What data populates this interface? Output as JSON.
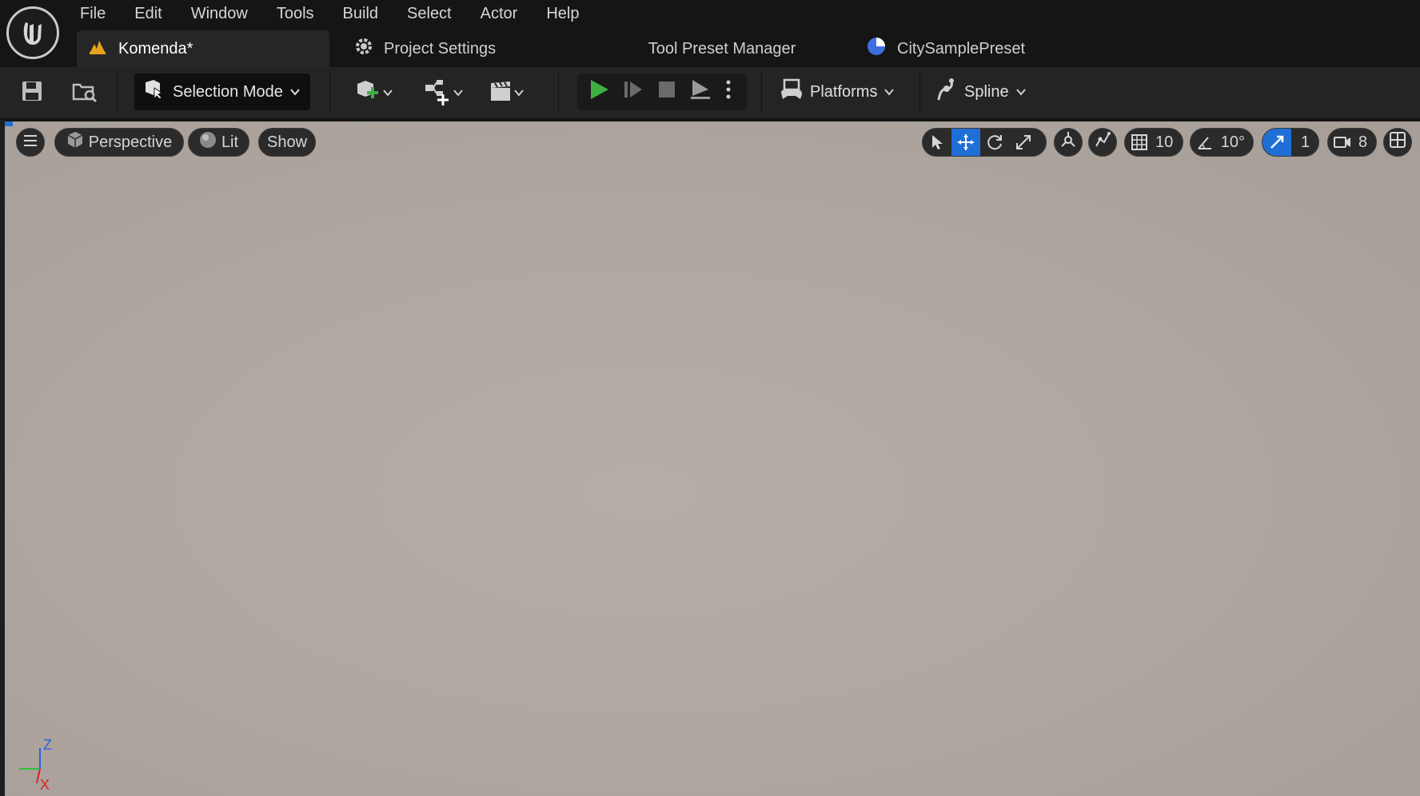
{
  "menu": {
    "items": [
      "File",
      "Edit",
      "Window",
      "Tools",
      "Build",
      "Select",
      "Actor",
      "Help"
    ]
  },
  "tabs": {
    "level": "Komenda*",
    "settings": "Project Settings",
    "preset_manager": "Tool Preset Manager",
    "city": "CitySamplePreset"
  },
  "toolbar": {
    "selection_mode": "Selection Mode",
    "platforms": "Platforms",
    "spline": "Spline"
  },
  "viewport": {
    "view_mode": "Perspective",
    "lighting": "Lit",
    "show": "Show",
    "grid_snap": "10",
    "rotation_snap": "10°",
    "scale_snap": "1",
    "camera_speed": "8",
    "axis_labels": {
      "z": "Z",
      "x": "X"
    }
  },
  "colors": {
    "accent": "#1f6fd6",
    "play_green": "#3fb043",
    "viewport": "#b0a8a1",
    "warning": "#e6a21a"
  },
  "icons": [
    "unreal-logo-icon",
    "level-warning-icon",
    "settings-gear-icon",
    "city-preset-icon",
    "save-icon",
    "content-browser-icon",
    "add-actor-icon",
    "blueprint-icon",
    "cinematics-icon",
    "play-icon",
    "advance-frame-icon",
    "stop-icon",
    "eject-icon",
    "more-icon",
    "platforms-icon",
    "spline-icon",
    "hamburger-icon",
    "perspective-cube-icon",
    "lit-sphere-icon",
    "select-arrow-icon",
    "translate-icon",
    "rotate-icon",
    "scale-icon",
    "world-local-icon",
    "surface-snap-icon",
    "grid-icon",
    "angle-icon",
    "scale-snap-icon",
    "camera-icon",
    "layout-icon"
  ]
}
